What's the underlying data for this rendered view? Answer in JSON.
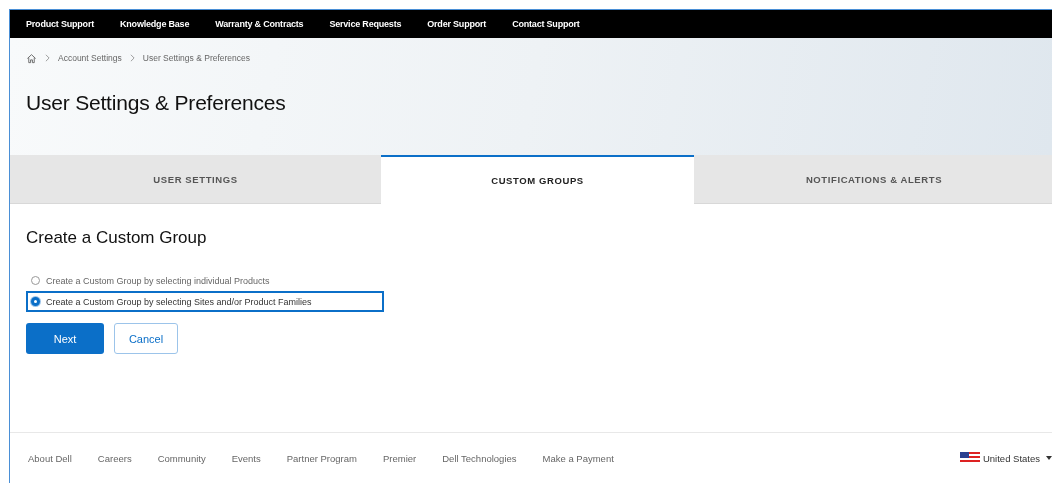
{
  "top_nav": [
    "Product Support",
    "Knowledge Base",
    "Warranty & Contracts",
    "Service Requests",
    "Order Support",
    "Contact Support"
  ],
  "breadcrumb": [
    "Account Settings",
    "User Settings & Preferences"
  ],
  "page_title": "User Settings & Preferences",
  "tabs": [
    {
      "label": "USER SETTINGS",
      "selected": false
    },
    {
      "label": "CUSTOM GROUPS",
      "selected": true
    },
    {
      "label": "NOTIFICATIONS & ALERTS",
      "selected": false
    }
  ],
  "section_title": "Create a Custom Group",
  "options": [
    {
      "label": "Create a Custom Group by selecting individual Products",
      "selected": false
    },
    {
      "label": "Create a Custom Group by selecting Sites and/or Product Families",
      "selected": true
    }
  ],
  "buttons": [
    {
      "label": "Next",
      "kind": "primary"
    },
    {
      "label": "Cancel",
      "kind": "secondary"
    }
  ],
  "footer_links": [
    "About Dell",
    "Careers",
    "Community",
    "Events",
    "Partner Program",
    "Premier",
    "Dell Technologies",
    "Make a Payment"
  ],
  "country": "United States"
}
